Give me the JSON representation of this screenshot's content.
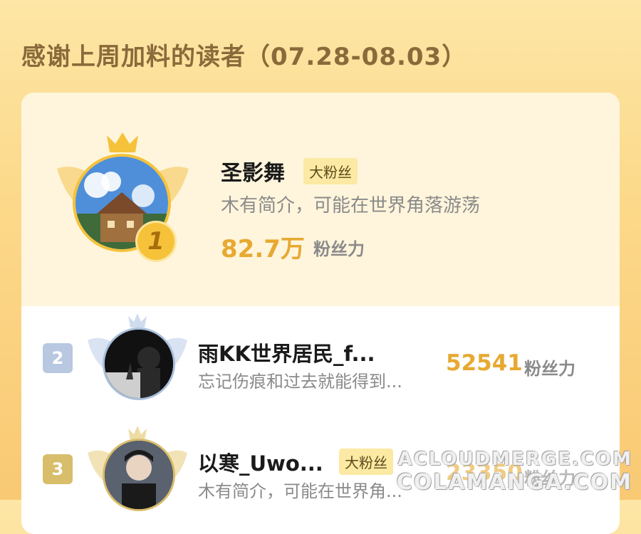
{
  "page": {
    "title": "感谢上周加料的读者（07.28-08.03）"
  },
  "ranking": [
    {
      "rank": "1",
      "name": "圣影舞",
      "badge": "大粉丝",
      "bio": "木有简介，可能在世界角落游荡",
      "score": "82.7万",
      "unit": "粉丝力"
    },
    {
      "rank": "2",
      "name": "雨KK世界居民_f...",
      "badge": "",
      "bio": "忘记伤痕和过去就能得到...",
      "score": "52541",
      "unit": "粉丝力"
    },
    {
      "rank": "3",
      "name": "以寒_Uwo...",
      "badge": "大粉丝",
      "bio": "木有简介，可能在世界角...",
      "score": "23350",
      "unit": "粉丝力"
    }
  ],
  "watermark": {
    "line1": "ACLOUDMERGE.COM",
    "line2": "COLAMANGA.COM"
  },
  "colors": {
    "score": "#e7a931",
    "gold": "#f5c23a",
    "silver": "#a9bfdc",
    "bronze": "#d8bd6a"
  }
}
